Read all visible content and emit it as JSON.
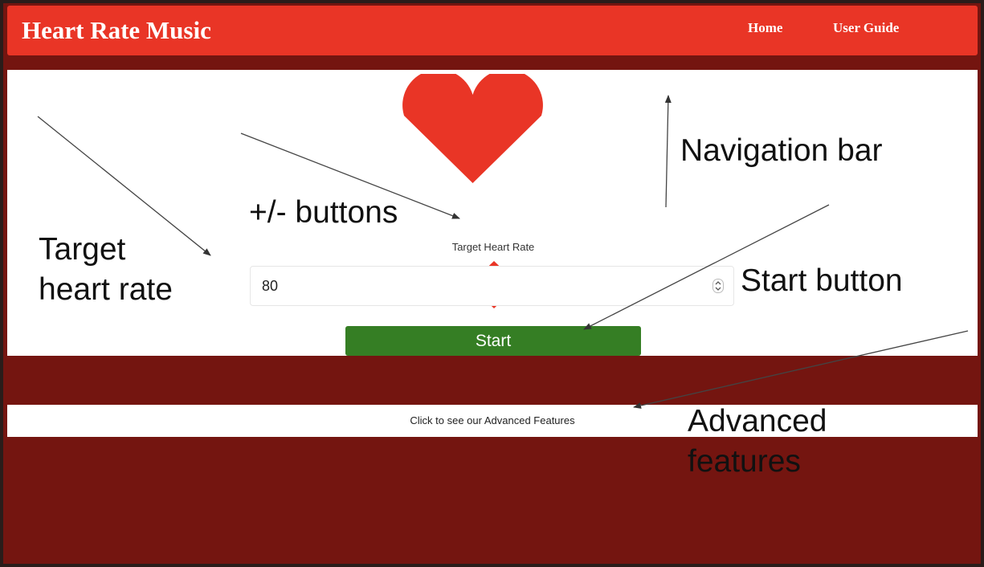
{
  "navbar": {
    "brand": "Heart Rate Music",
    "links": [
      "Home",
      "User Guide"
    ]
  },
  "main": {
    "heart_icon": "heart-icon",
    "increment_icon": "triangle-up-icon",
    "decrement_icon": "triangle-down-icon",
    "target_label": "Target Heart Rate",
    "target_value": "80",
    "start_label": "Start"
  },
  "advanced": {
    "link_text": "Click to see our Advanced Features"
  },
  "annotations": {
    "target_heart_rate_line1": "Target",
    "target_heart_rate_line2": "heart rate",
    "plus_minus_buttons": "+/- buttons",
    "navigation_bar": "Navigation bar",
    "start_button": "Start button",
    "advanced_features_line1": "Advanced",
    "advanced_features_line2": "features"
  },
  "colors": {
    "navbar": "#e93526",
    "background": "#741510",
    "start_button": "#357e24",
    "heart": "#e93526"
  }
}
